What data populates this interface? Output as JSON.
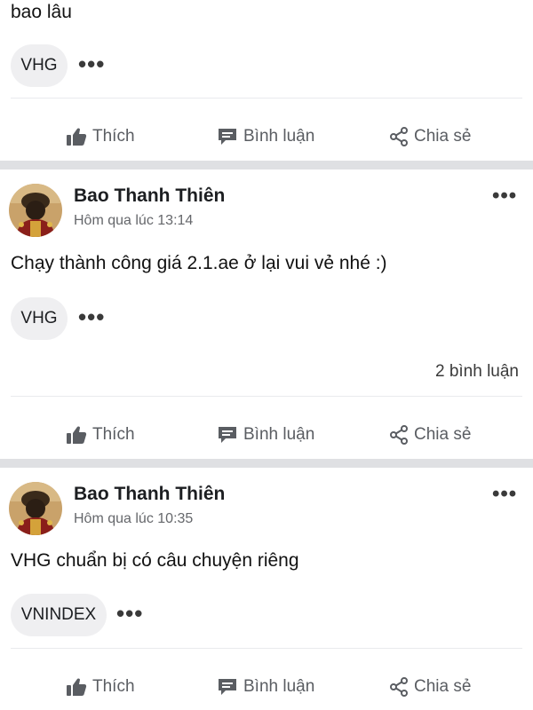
{
  "post0": {
    "text": "bao lâu",
    "tag": "VHG"
  },
  "actions": {
    "like": "Thích",
    "comment": "Bình luận",
    "share": "Chia sẻ"
  },
  "post1": {
    "author": "Bao Thanh Thiên",
    "time": "Hôm qua lúc 13:14",
    "text": "Chạy thành công giá 2.1.ae ở lại vui vẻ nhé :)",
    "tag": "VHG",
    "comments": "2 bình luận"
  },
  "post2": {
    "author": "Bao Thanh Thiên",
    "time": "Hôm qua lúc 10:35",
    "text": "VHG chuẩn bị có câu chuyện riêng",
    "tag": "VNINDEX"
  },
  "icons": {
    "like": "thumbs-up-icon",
    "comment": "comment-icon",
    "share": "share-icon",
    "more": "more-options-icon"
  }
}
